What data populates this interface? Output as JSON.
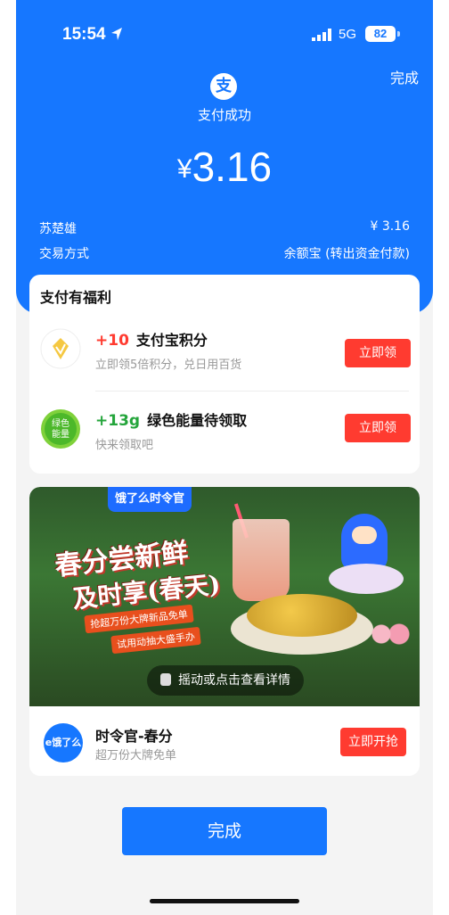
{
  "status_bar": {
    "time": "15:54",
    "network": "5G",
    "battery": "82"
  },
  "header": {
    "done_top": "完成",
    "logo_char": "支",
    "pay_status": "支付成功",
    "currency": "¥",
    "amount": "3.16"
  },
  "info": {
    "payee": "苏楚雄",
    "payee_amount": "¥ 3.16",
    "method_label": "交易方式",
    "method_value": "余额宝 (转出资金付款)"
  },
  "benefits": {
    "title": "支付有福利",
    "items": [
      {
        "points": "+10",
        "name": "支付宝积分",
        "sub": "立即领5倍积分，兑日用百货",
        "button": "立即领"
      },
      {
        "points": "+13g",
        "name": "绿色能量待领取",
        "sub": "快来领取吧",
        "button": "立即领",
        "icon_text": "绿色能量"
      }
    ]
  },
  "ad": {
    "tag": "饿了么时令官",
    "headline1": "春分尝新鲜",
    "headline2": "及时享(春天)",
    "slogan1": "抢超万份大牌新品免单",
    "slogan2": "试用动抽大盛手办",
    "shake_text": "摇动或点击查看详情",
    "logo_text": "e饿了么",
    "title": "时令官-春分",
    "sub": "超万份大牌免单",
    "button": "立即开抢"
  },
  "footer": {
    "done": "完成"
  },
  "colors": {
    "brand_blue": "#1677ff",
    "action_red": "#ff3b30",
    "points_red": "#ff3b30",
    "energy_green": "#24a53b"
  }
}
